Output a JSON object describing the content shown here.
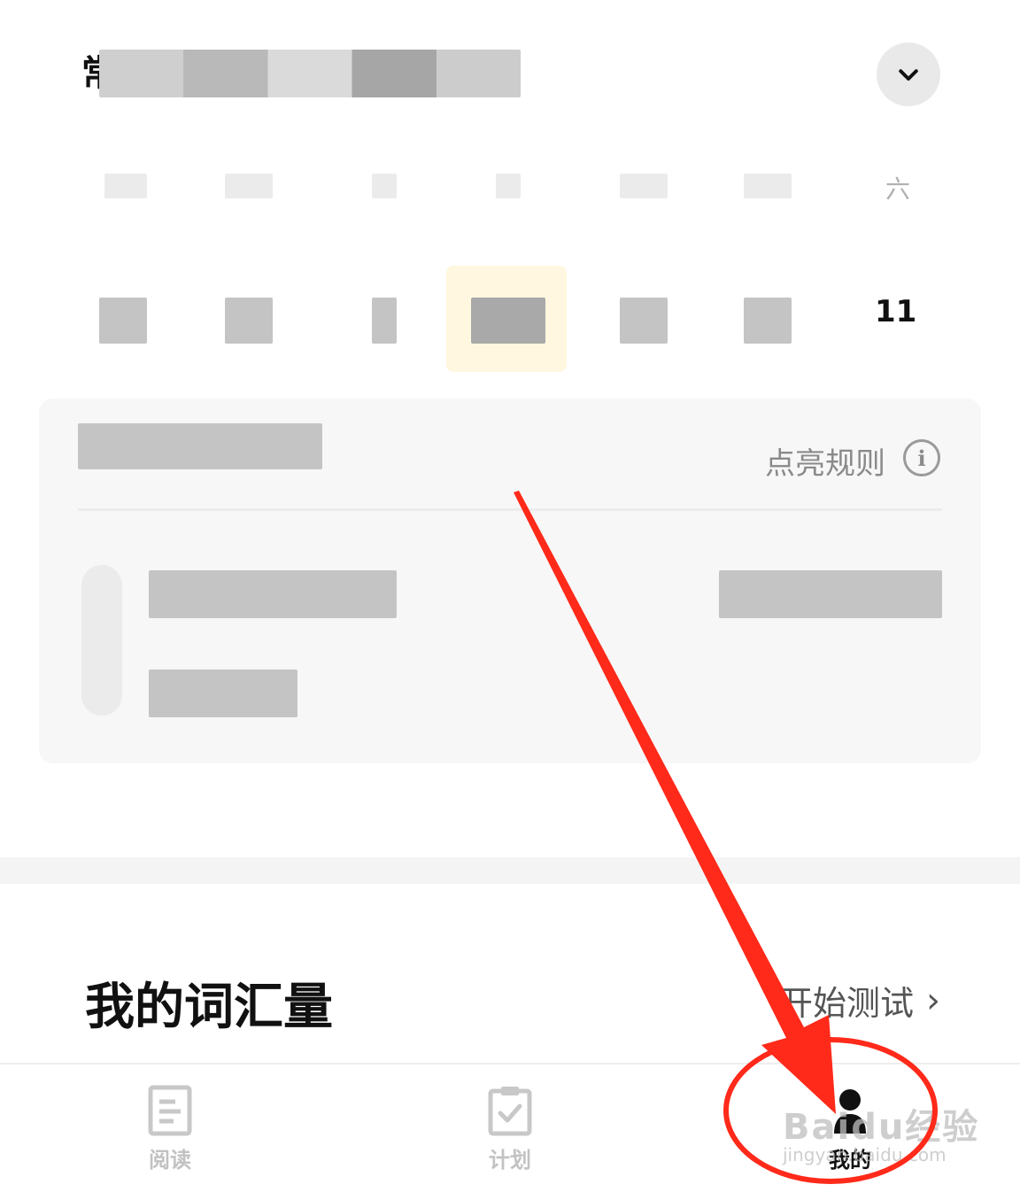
{
  "header": {
    "title_partial": "常",
    "collapse_icon": "chevron-down-icon"
  },
  "calendar": {
    "week_last_label": "六",
    "last_day_number": "11",
    "today_highlight_color": "#fff7df"
  },
  "card": {
    "rules_label": "点亮规则",
    "info_icon_glyph": "i"
  },
  "vocab": {
    "title": "我的词汇量",
    "start_test_label": "开始测试",
    "chevron": "›"
  },
  "tabbar": {
    "items": [
      {
        "label": "阅读",
        "icon": "reading-doc-icon"
      },
      {
        "label": "计划",
        "icon": "plan-clipboard-icon"
      },
      {
        "label": "我的",
        "icon": "profile-icon"
      }
    ]
  },
  "watermark": {
    "main": "Baidu经验",
    "sub": "jingyan.baidu.com"
  },
  "annotation": {
    "color": "#ff2a1a"
  }
}
